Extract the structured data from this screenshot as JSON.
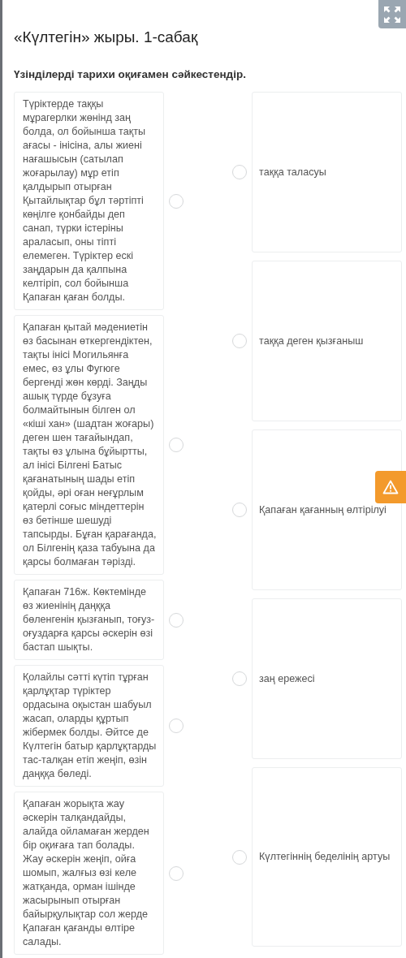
{
  "title": "«Күлтегін» жыры. 1-сабақ",
  "instruction": "Үзінділерді тарихи оқиғамен сәйкестендір.",
  "left_items": [
    {
      "text": "Түріктерде таққы мұрагерлки жөнінд заң болда, ол бойынша тақты ағасы - інісіна, алы жиені нағашысын (сатылап жоғарылау) мұр етіп қалдырып отырған Қытайлықтар бұл тәртіпті көңілге қонбайды деп санап, түрки істеріны араласып, оны тіпті елемеген. Түріктер ескі заңдарын да қалпына келтіріп, сол бойынша Қапаған қаған болды.",
      "selected": false
    },
    {
      "text": "Қапаған қытай мәдениетін өз басынан өткергендіктен, тақты інісі Могильянға емес, өз ұлы Фугюге бергенді жөн көрді. Заңды ашық түрде бұзуға болмайтынын білген ол «кіші хан» (шадтан жоғары) деген шен тағайындап, тақты өз ұлына бұйыртты, ал інісі Білгені Батыс қағанатының шады етіп қойды, әрі оған неғұрлым қатерлі соғыс міндеттерін өз бетінше шешуді тапсырды. Бұған қарағанда, ол Білгенің қаза табуына да қарсы болмаған тәрізді.",
      "selected": false
    },
    {
      "text": "Қапаған 716ж. Көктемінде өз жиенінің даңққа бөленгенін қызғанып, тоғуз-оғуздарға қарсы әскерін өзі бастап шықты.",
      "selected": false
    },
    {
      "text": "Қолайлы сәтті күтіп тұрған қарлұқтар түріктер ордасына оқыстан шабуыл жасап, оларды құртып жібермек болды. Әйтсе де Күлтегін батыр қарлұқтарды тас-талқан етіп жеңіп, өзін даңққа бөледі.",
      "selected": false
    },
    {
      "text": "Қапаған жорықта жау әскерін талқандайды, алайда ойламаған жерден бір оқиғаға тап болады. Жау әскерін жеңіп, ойға шомып, жалғыз өзі келе жатқанда, орман ішінде жасырынып отырған байырқулықтар сол жерде Қапаған қағанды өлтіре салады.",
      "selected": false
    }
  ],
  "right_items": [
    {
      "text": "таққа таласуы",
      "selected": false
    },
    {
      "text": "таққа деген қызғаныш",
      "selected": false
    },
    {
      "text": "Қапаған қағанның өлтірілуі",
      "selected": false
    },
    {
      "text": "заң ережесі",
      "selected": false
    },
    {
      "text": "Күлтегіннің беделінің артуы",
      "selected": false
    }
  ]
}
